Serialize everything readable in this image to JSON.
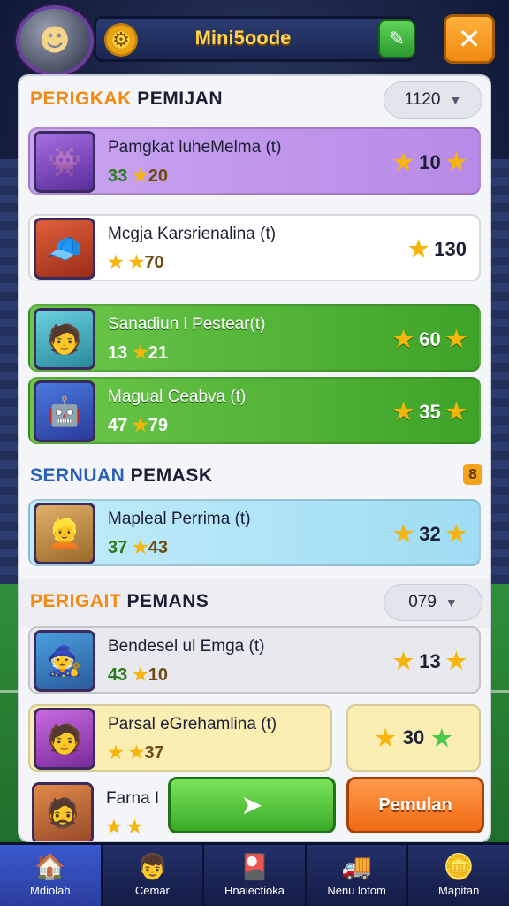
{
  "header": {
    "title": "Mini5oode",
    "gear_icon": "gear-icon",
    "chat_icon": "chat-icon",
    "close_icon": "close-icon"
  },
  "section1": {
    "title_accent": "PERIGKAK",
    "title_rest": " PEMIJAN",
    "dropdown_value": "1120",
    "rows": [
      {
        "name": "Pamgkat luheMelma (t)",
        "stat1": "33",
        "stat2": "20",
        "score": "10"
      },
      {
        "name": "Mcgja Karsrienalina (t)",
        "stat1": "",
        "stat2": "70",
        "score": "130"
      },
      {
        "name": "Sanadiun l Pestear(t)",
        "stat1": "13",
        "stat2": "21",
        "score": "60"
      },
      {
        "name": "Magual Ceabva (t)",
        "stat1": "47",
        "stat2": "79",
        "score": "35"
      }
    ]
  },
  "section2": {
    "title_accent": "SERNUAN",
    "title_rest": " PEMASK",
    "badge": "8",
    "rows": [
      {
        "name": "Mapleal Perrima (t)",
        "stat1": "37",
        "stat2": "43",
        "score": "32"
      }
    ]
  },
  "section3": {
    "title_accent": "PERIGAIT",
    "title_rest": " PEMANS",
    "dropdown_value": "079",
    "rows": [
      {
        "name": "Bendesel ul Emga (t)",
        "stat1": "43",
        "stat2": "10",
        "score": "13"
      },
      {
        "name": "Parsal eGrehamlina (t)",
        "stat1": "",
        "stat2": "37",
        "score": "30"
      },
      {
        "name": "Farna I",
        "stat1": "",
        "stat2": "",
        "score": ""
      }
    ]
  },
  "actions": {
    "arrow_icon": "arrow-right-icon",
    "primary_label": "Pemulan"
  },
  "nav": [
    {
      "label": "Mdiolah",
      "icon": "home-icon",
      "active": true
    },
    {
      "label": "Cemar",
      "icon": "player-icon",
      "active": false
    },
    {
      "label": "Hnaiectioka",
      "icon": "cards-icon",
      "active": false
    },
    {
      "label": "Nenu lotom",
      "icon": "shop-icon",
      "active": false
    },
    {
      "label": "Mapitan",
      "icon": "coins-icon",
      "active": false
    }
  ],
  "colors": {
    "accent_orange": "#f08a12",
    "accent_gold": "#ffd34d",
    "brand_green": "#3ea329",
    "purple_row": "#c9a5f0",
    "cyan_row": "#c2ecfa"
  }
}
